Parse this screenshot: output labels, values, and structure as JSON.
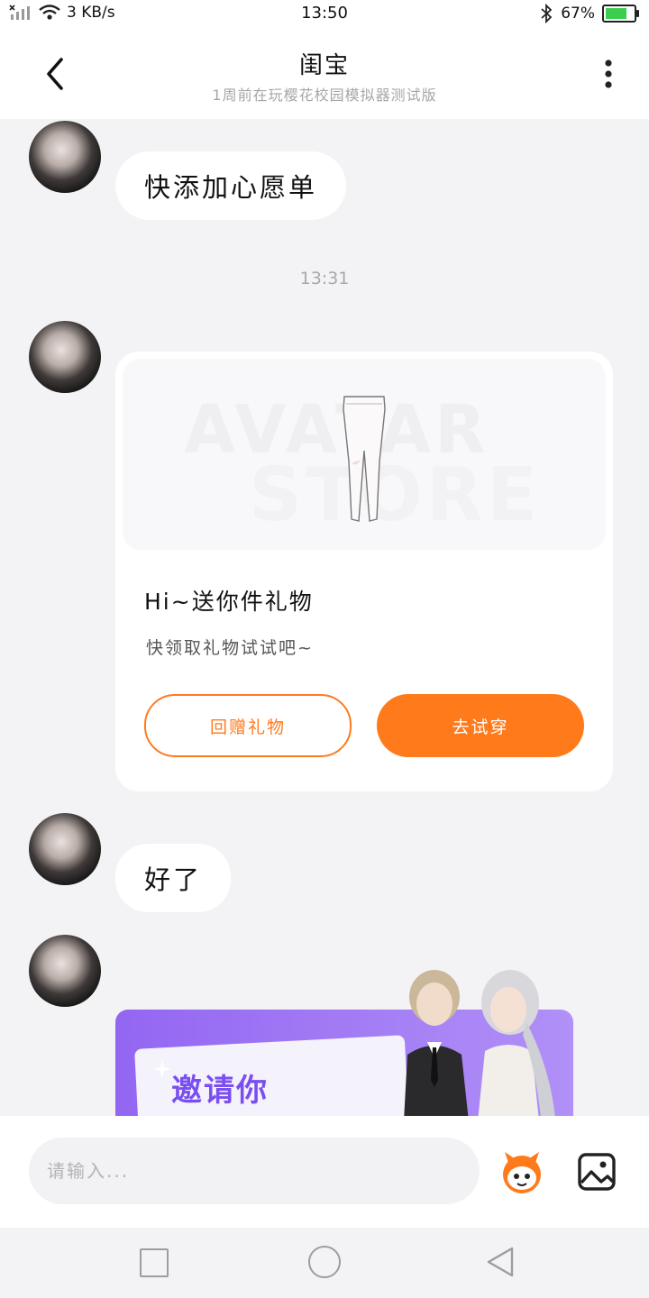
{
  "status_bar": {
    "network_speed": "3 KB/s",
    "time": "13:50",
    "battery": "67%",
    "battery_level": 0.67
  },
  "header": {
    "title": "闺宝",
    "subtitle": "1周前在玩樱花校园模拟器测试版"
  },
  "messages": [
    {
      "type": "text",
      "text": "快添加心愿单"
    },
    {
      "type": "timestamp",
      "text": "13:31"
    },
    {
      "type": "gift_card",
      "watermark_line1": "AVATAR",
      "watermark_line2": "STORE",
      "title": "Hi~送你件礼物",
      "subtitle": "快领取礼物试试吧~",
      "secondary_button": "回赠礼物",
      "primary_button": "去试穿"
    },
    {
      "type": "text",
      "text": "好了"
    },
    {
      "type": "promo_card",
      "headline": "邀请你"
    }
  ],
  "input": {
    "placeholder": "请输入..."
  },
  "colors": {
    "accent_orange": "#ff7a1a",
    "promo_purple": "#9366f2",
    "background": "#f3f3f5"
  },
  "icons": {
    "back": "chevron-left-icon",
    "more": "more-vertical-icon",
    "emoji": "mascot-emoji-icon",
    "image": "image-icon"
  }
}
